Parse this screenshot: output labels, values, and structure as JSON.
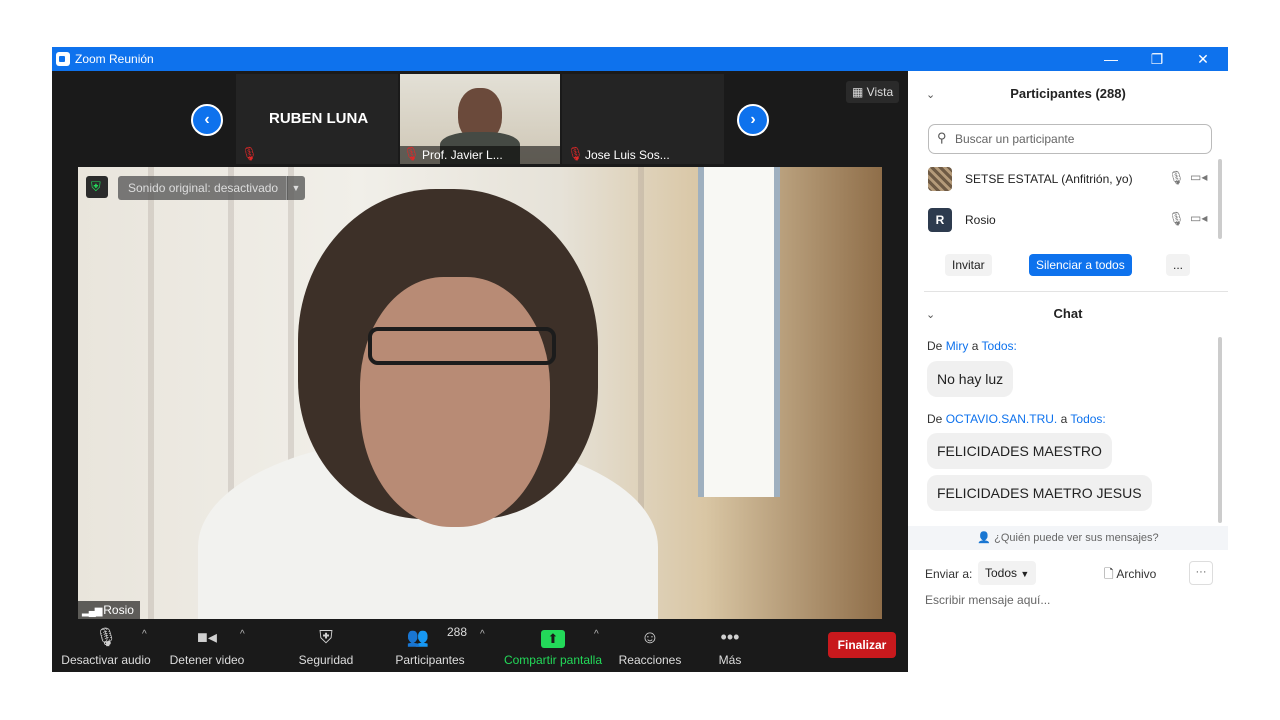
{
  "window": {
    "title": "Zoom Reunión",
    "minimize": "—",
    "restore": "❐",
    "close": "✕"
  },
  "meeting": {
    "vista_label": "Vista",
    "vista_icon": "grid-icon",
    "strip": [
      {
        "name": "RUBEN LUNA",
        "muted": true
      },
      {
        "name": "Prof. Javier L...",
        "muted": true
      },
      {
        "name": "Jose Luis Sos...",
        "muted": true
      }
    ],
    "original_sound": "Sonido original: desactivado",
    "active_speaker": "Rosio"
  },
  "toolbar": {
    "audio": "Desactivar audio",
    "video": "Detener video",
    "security": "Seguridad",
    "participants": "Participantes",
    "participants_count": "288",
    "share": "Compartir pantalla",
    "reactions": "Reacciones",
    "more": "Más",
    "end": "Finalizar",
    "share_color": "#23d959",
    "end_color": "#c8191d"
  },
  "participants": {
    "title": "Participantes (288)",
    "search_placeholder": "Buscar un participante",
    "list": [
      {
        "name": "SETSE ESTATAL (Anfitrión, yo)"
      },
      {
        "name": "Rosio",
        "initial": "R"
      }
    ],
    "invite": "Invitar",
    "mute_all": "Silenciar a todos",
    "more": "..."
  },
  "chat": {
    "title": "Chat",
    "messages": [
      {
        "prefix": "De",
        "from": "Miry",
        "mid": "a",
        "to": "Todos:",
        "text": "No hay luz"
      },
      {
        "prefix": "De",
        "from": "OCTAVIO.SAN.TRU.",
        "mid": "a",
        "to": "Todos:",
        "texts": [
          "FELICIDADES MAESTRO",
          "FELICIDADES MAETRO JESUS"
        ]
      }
    ],
    "who_can_see": "¿Quién puede ver sus mensajes?",
    "send_to_label": "Enviar a:",
    "send_to_value": "Todos",
    "file_label": "Archivo",
    "input_placeholder": "Escribir mensaje aquí..."
  }
}
